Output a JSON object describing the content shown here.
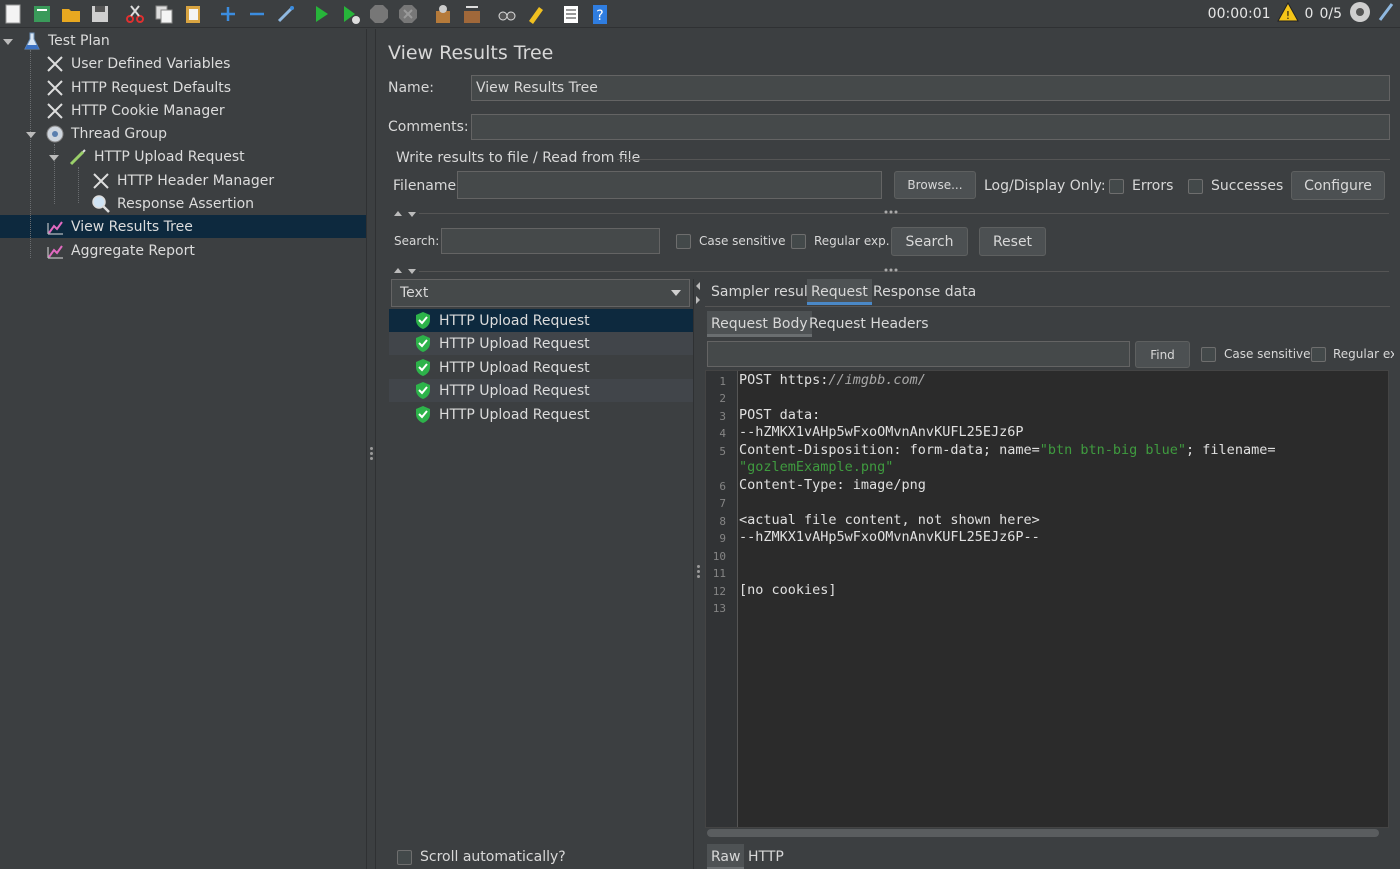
{
  "toolbar": {
    "timer": "00:00:01",
    "warn_count": "0",
    "threads": "0/5",
    "icons": [
      "new-icon",
      "templates-icon",
      "open-icon",
      "save-icon",
      "cut-icon",
      "copy-icon",
      "paste-icon",
      "expand-icon",
      "collapse-icon",
      "toggle-icon",
      "start-icon",
      "start-no-pauses-icon",
      "stop-icon",
      "shutdown-icon",
      "clear-icon",
      "clear-all-icon",
      "search-icon",
      "reset-search-icon",
      "function-helper-icon",
      "help-icon"
    ]
  },
  "tree": {
    "items": [
      {
        "label": "Test Plan"
      },
      {
        "label": "User Defined Variables"
      },
      {
        "label": "HTTP Request Defaults"
      },
      {
        "label": "HTTP Cookie Manager"
      },
      {
        "label": "Thread Group"
      },
      {
        "label": "HTTP Upload Request"
      },
      {
        "label": "HTTP Header Manager"
      },
      {
        "label": "Response Assertion"
      },
      {
        "label": "View Results Tree"
      },
      {
        "label": "Aggregate Report"
      }
    ]
  },
  "panel": {
    "title": "View Results Tree",
    "name_label": "Name:",
    "name_value": "View Results Tree",
    "comments_label": "Comments:",
    "file_section": "Write results to file / Read from file",
    "filename_label": "Filename",
    "browse": "Browse...",
    "log_display": "Log/Display Only:",
    "errors": "Errors",
    "successes": "Successes",
    "configure": "Configure",
    "search_label": "Search:",
    "case_sensitive": "Case sensitive",
    "regular_exp": "Regular exp.",
    "search_btn": "Search",
    "reset_btn": "Reset",
    "renderer": "Text",
    "results": [
      "HTTP Upload Request",
      "HTTP Upload Request",
      "HTTP Upload Request",
      "HTTP Upload Request",
      "HTTP Upload Request"
    ],
    "scroll_auto": "Scroll automatically?"
  },
  "detail": {
    "tabs": [
      "Sampler result",
      "Request",
      "Response data"
    ],
    "subtabs": [
      "Request Body",
      "Request Headers"
    ],
    "find": "Find",
    "case_sensitive": "Case sensitive",
    "regular_exp": "Regular exp",
    "bottom_tabs": [
      "Raw",
      "HTTP"
    ],
    "code": {
      "l1a": "POST https:",
      "l1b": "//imgbb.com/",
      "l3": "POST data:",
      "l4": "--hZMKX1vAHp5wFxoOMvnAnvKUFL25EJz6P",
      "l5a": "Content-Disposition: form-data; name=",
      "l5b": "\"btn btn-big blue\"",
      "l5c": "; filename=",
      "l5d": "\"gozlemExample.png\"",
      "l6": "Content-Type: image/png",
      "l8": "<actual file content, not shown here>",
      "l9": "--hZMKX1vAHp5wFxoOMvnAnvKUFL25EJz6P--",
      "l12": "[no cookies]"
    },
    "line_numbers": [
      "1",
      "2",
      "3",
      "4",
      "5",
      "6",
      "7",
      "8",
      "9",
      "10",
      "11",
      "12",
      "13"
    ]
  }
}
